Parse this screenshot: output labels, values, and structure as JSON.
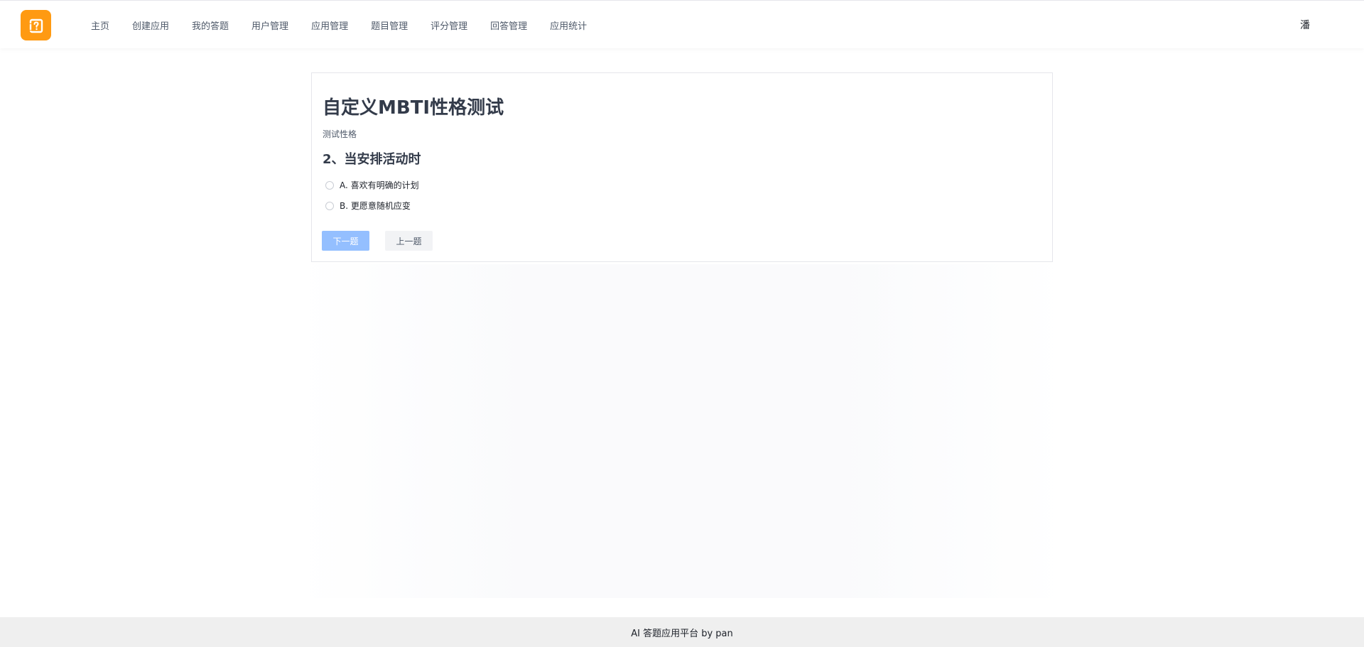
{
  "app": {
    "logo_icon": "question-square-icon",
    "brand_color": "#ff9a12"
  },
  "nav": {
    "items": [
      {
        "label": "主页"
      },
      {
        "label": "创建应用"
      },
      {
        "label": "我的答题"
      },
      {
        "label": "用户管理"
      },
      {
        "label": "应用管理"
      },
      {
        "label": "题目管理"
      },
      {
        "label": "评分管理"
      },
      {
        "label": "回答管理"
      },
      {
        "label": "应用统计"
      }
    ],
    "user_name": "潘"
  },
  "quiz": {
    "title": "自定义MBTI性格测试",
    "description": "测试性格",
    "question": "2、当安排活动时",
    "options": [
      {
        "label": "A. 喜欢有明确的计划"
      },
      {
        "label": "B. 更愿意随机应变"
      }
    ],
    "next_label": "下一题",
    "prev_label": "上一题",
    "next_disabled": true
  },
  "footer": {
    "text": "AI 答题应用平台 by pan"
  },
  "colors": {
    "primary_disabled": "#94bfff",
    "secondary_bg": "#f2f3f5",
    "footer_bg": "#efefef"
  }
}
